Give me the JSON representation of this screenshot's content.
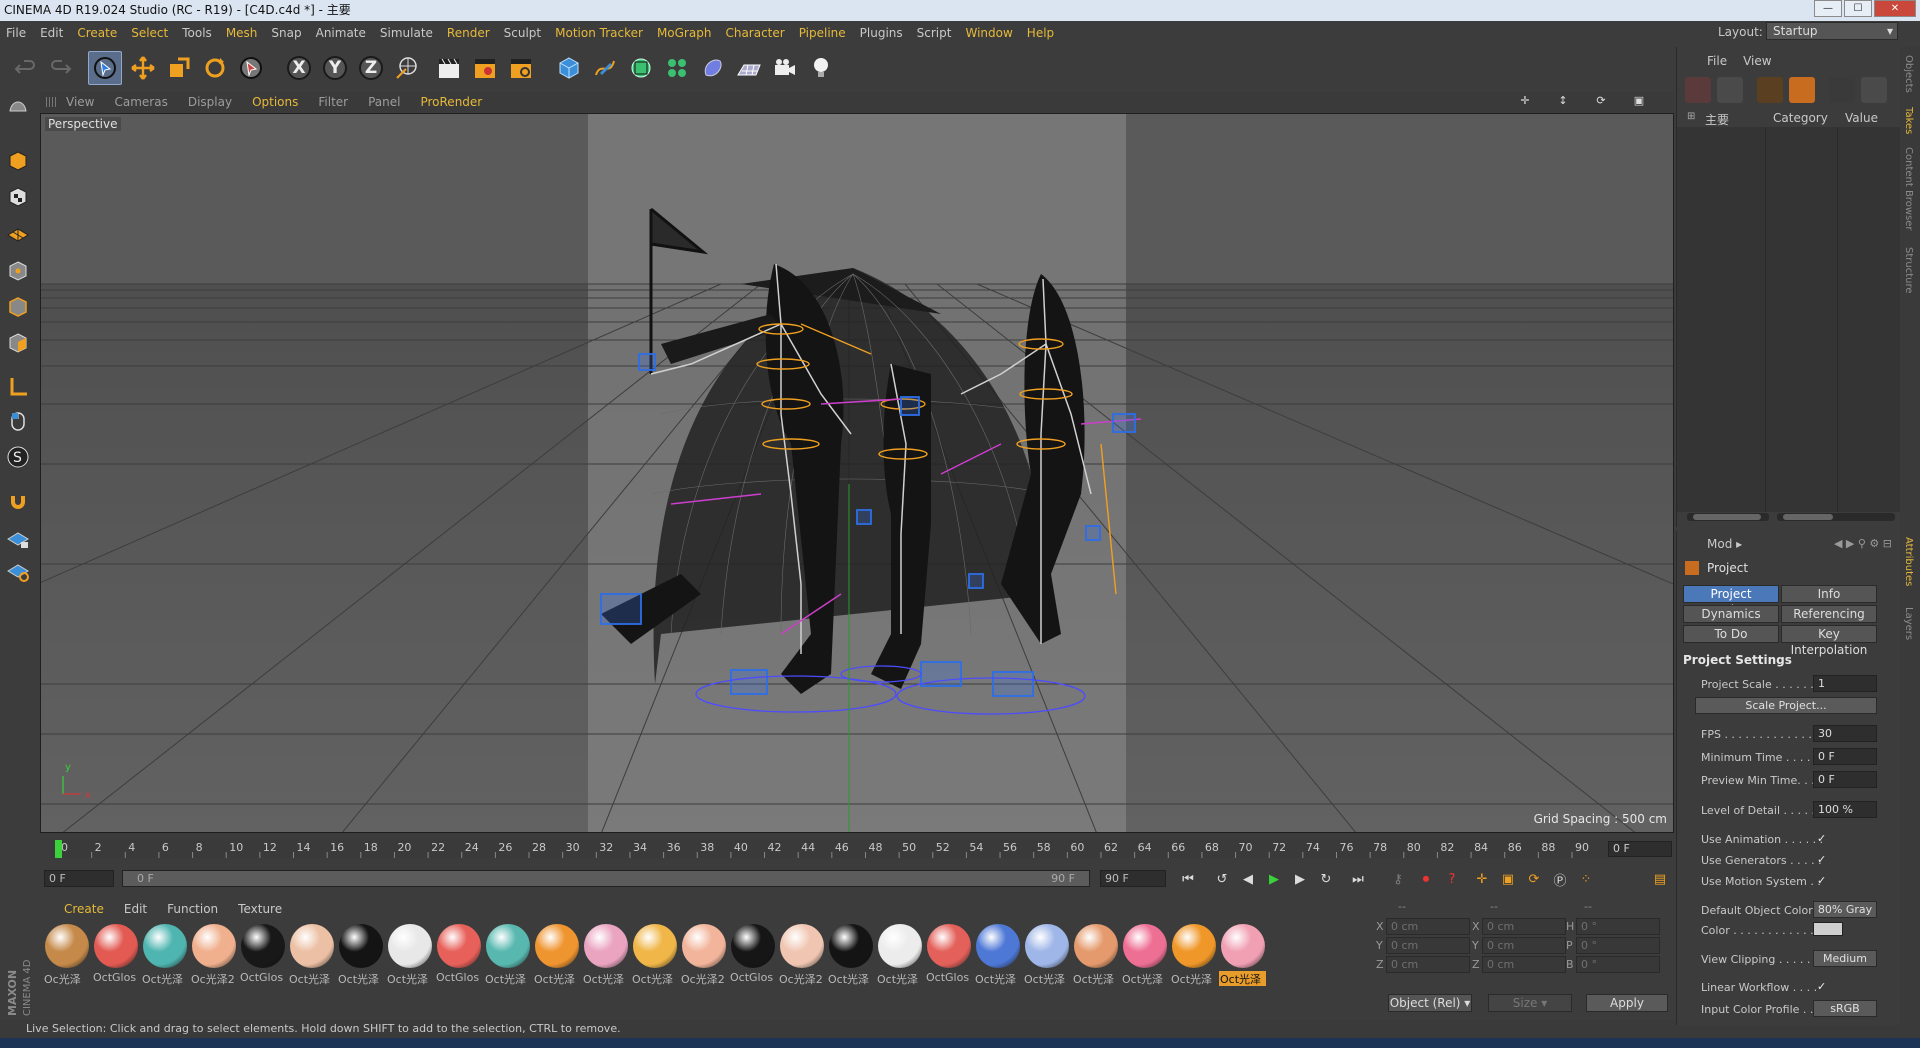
{
  "window": {
    "title": "CINEMA 4D R19.024 Studio (RC - R19) - [C4D.c4d *] - 主要",
    "buttons": [
      "—",
      "☐",
      "✕"
    ]
  },
  "menubar": {
    "items": [
      "File",
      "Edit",
      "Create",
      "Select",
      "Tools",
      "Mesh",
      "Snap",
      "Animate",
      "Simulate",
      "Render",
      "Sculpt",
      "Motion Tracker",
      "MoGraph",
      "Character",
      "Pipeline",
      "Plugins",
      "Script",
      "Window",
      "Help"
    ],
    "layout_label": "Layout:",
    "layout_value": "Startup"
  },
  "toolbar": {
    "axis_x": "X",
    "axis_y": "Y",
    "axis_z": "Z"
  },
  "viewport": {
    "menu": [
      "View",
      "Cameras",
      "Display",
      "Options",
      "Filter",
      "Panel",
      "ProRender"
    ],
    "label": "Perspective",
    "grid_spacing": "Grid Spacing : 500 cm",
    "axis_y": "y",
    "axis_x": "x"
  },
  "timeline": {
    "ticks": [
      "0",
      "2",
      "4",
      "6",
      "8",
      "10",
      "12",
      "14",
      "16",
      "18",
      "20",
      "22",
      "24",
      "26",
      "28",
      "30",
      "32",
      "34",
      "36",
      "38",
      "40",
      "42",
      "44",
      "46",
      "48",
      "50",
      "52",
      "54",
      "56",
      "58",
      "60",
      "62",
      "64",
      "66",
      "68",
      "70",
      "72",
      "74",
      "76",
      "78",
      "80",
      "82",
      "84",
      "86",
      "88",
      "90"
    ],
    "current_frame": "0 F",
    "start": "0 F",
    "range_start": "0 F",
    "range_end": "90 F",
    "end": "90 F",
    "playhead": 0,
    "max_frame": 90
  },
  "materials": {
    "menu": [
      "Create",
      "Edit",
      "Function",
      "Texture"
    ],
    "items": [
      {
        "label": "Oc光泽",
        "color": "#c58a4a"
      },
      {
        "label": "OctGlos",
        "color": "#e25a52"
      },
      {
        "label": "Oct光泽",
        "color": "#4fb5b0"
      },
      {
        "label": "Oc光泽2",
        "color": "#f0b08e"
      },
      {
        "label": "OctGlos",
        "color": "#181818"
      },
      {
        "label": "Oct光泽",
        "color": "#ecc0a4"
      },
      {
        "label": "Oct光泽",
        "color": "#141414"
      },
      {
        "label": "Oct光泽",
        "color": "#e8e8e8"
      },
      {
        "label": "OctGlos",
        "color": "#e8605a"
      },
      {
        "label": "Oct光泽",
        "color": "#58b8b0"
      },
      {
        "label": "Oct光泽",
        "color": "#ef9530"
      },
      {
        "label": "Oct光泽",
        "color": "#eaa4c0"
      },
      {
        "label": "Oct光泽",
        "color": "#f0b648"
      },
      {
        "label": "Oc光泽2",
        "color": "#f2b49a"
      },
      {
        "label": "OctGlos",
        "color": "#161616"
      },
      {
        "label": "Oc光泽2",
        "color": "#f0c6b2"
      },
      {
        "label": "Oct光泽",
        "color": "#141414"
      },
      {
        "label": "Oct光泽",
        "color": "#ececec"
      },
      {
        "label": "OctGlos",
        "color": "#e4605a"
      },
      {
        "label": "Oct光泽",
        "color": "#4e78d6"
      },
      {
        "label": "Oct光泽",
        "color": "#9fb6e8"
      },
      {
        "label": "Oct光泽",
        "color": "#e49a6c"
      },
      {
        "label": "Oct光泽",
        "color": "#ee6f94"
      },
      {
        "label": "Oct光泽",
        "color": "#ef9728"
      },
      {
        "label": "Oct光泽",
        "color": "#f1a0b4"
      }
    ],
    "selected_index": 24
  },
  "coords": {
    "headers": [
      "--",
      "--",
      "--"
    ],
    "rows": [
      {
        "a": "X",
        "av": "0 cm",
        "b": "X",
        "bv": "0 cm",
        "c": "H",
        "cv": "0 °"
      },
      {
        "a": "Y",
        "av": "0 cm",
        "b": "Y",
        "bv": "0 cm",
        "c": "P",
        "cv": "0 °"
      },
      {
        "a": "Z",
        "av": "0 cm",
        "b": "Z",
        "bv": "0 cm",
        "c": "B",
        "cv": "0 °"
      }
    ],
    "mode": "Object (Rel)",
    "size": "Size",
    "apply": "Apply"
  },
  "status": "Live Selection: Click and drag to select elements. Hold down SHIFT to add to the selection, CTRL to remove.",
  "objects_panel": {
    "menu": [
      "File",
      "View"
    ],
    "col_name": "主要",
    "col_category": "Category",
    "col_value": "Value"
  },
  "attributes": {
    "mode": "Mod",
    "title": "Project",
    "tabs": [
      "Project Settings",
      "Info",
      "Dynamics",
      "Referencing",
      "To Do",
      "Key Interpolation"
    ],
    "section": "Project Settings",
    "project_scale_label": "Project Scale . . . . . . .",
    "project_scale": "1",
    "scale_project": "Scale Project...",
    "fps_label": "FPS . . . . . . . . . . . . . .",
    "fps": "30",
    "min_time_label": "Minimum Time . . . . . .",
    "min_time": "0 F",
    "preview_min_label": "Preview Min Time. . . .",
    "preview_min": "0 F",
    "lod_label": "Level of Detail . . . . . .",
    "lod": "100 %",
    "use_anim_label": "Use Animation . . . . . .",
    "use_gen_label": "Use Generators . . . . .",
    "use_motion_label": "Use Motion System . .",
    "check": "✓",
    "def_color_label": "Default Object Color",
    "def_color": "80% Gray",
    "color_label": "Color . . . . . . . . . . . .",
    "view_clip_label": "View Clipping . . . . . .",
    "view_clip": "Medium",
    "linear_label": "Linear Workflow . . . .",
    "input_profile_label": "Input Color Profile . . .",
    "input_profile": "sRGB"
  },
  "side_tabs": [
    "Objects",
    "Takes",
    "Content Browser",
    "Structure",
    "Attributes",
    "Layers"
  ],
  "brand": "MAXON CINEMA 4D"
}
